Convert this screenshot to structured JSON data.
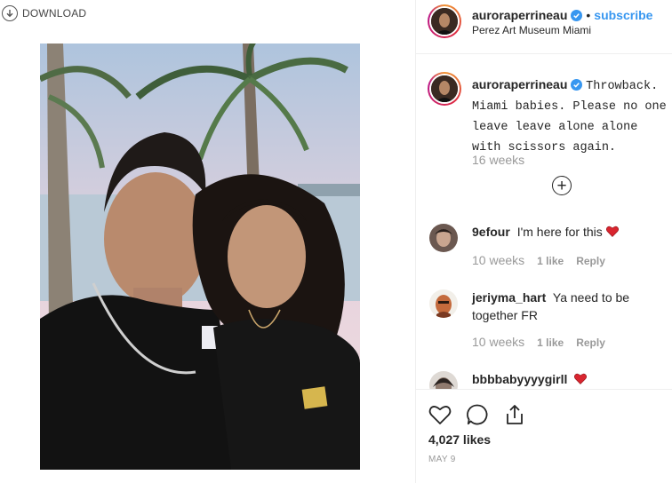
{
  "download": {
    "label": "DOWNLOAD",
    "icon": "download-icon"
  },
  "post": {
    "username": "auroraperrineau",
    "verified": true,
    "subscribe_label": "subscribe",
    "separator": "•",
    "location": "Perez Art Museum Miami",
    "caption": "Throwback. Miami babies. Please no one leave leave alone alone with scissors again.",
    "caption_time": "16 weeks",
    "load_more_icon": "plus-circle-icon",
    "likes": "4,027 likes",
    "date": "MAY 9"
  },
  "comments": [
    {
      "username": "9efour",
      "text": "I'm here for this",
      "emoji": "red-heart",
      "time": "10 weeks",
      "likes": "1 like",
      "reply": "Reply"
    },
    {
      "username": "jeriyma_hart",
      "text": "Ya need to be together FR",
      "emoji": "",
      "time": "10 weeks",
      "likes": "1 like",
      "reply": "Reply"
    },
    {
      "username": "bbbbabyyyygirll",
      "text": "",
      "emoji": "red-heart",
      "time": "",
      "likes": "",
      "reply": ""
    }
  ],
  "icons": {
    "like": "heart-outline-icon",
    "comment": "comment-icon",
    "share": "share-icon",
    "verified": "verified-badge-icon"
  },
  "colors": {
    "accent": "#3897f0",
    "heart": "#ed4956",
    "muted": "#999999",
    "border": "#efefef"
  }
}
